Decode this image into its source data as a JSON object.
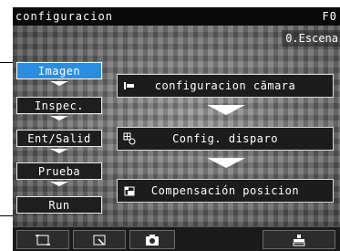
{
  "title": "configuracion",
  "title_right": "F0",
  "scene": "0.Escena",
  "menu": {
    "items": [
      {
        "label": "Imagen",
        "selected": true
      },
      {
        "label": "Inspec.",
        "selected": false
      },
      {
        "label": "Ent/Salid",
        "selected": false
      },
      {
        "label": "Prueba",
        "selected": false
      },
      {
        "label": "Run",
        "selected": false
      }
    ]
  },
  "functions": {
    "camera_label": "configuracion cãmara",
    "trigger_label": "Config. disparo",
    "position_label": "Compensación posicion"
  },
  "icons": {
    "camera_setup": "camera-setup-icon",
    "trigger": "trigger-icon",
    "position": "position-compensation-icon",
    "toolbar": [
      "display-frame-icon",
      "zoom-window-icon",
      "camera-capture-icon",
      "output-icon"
    ]
  },
  "colors": {
    "selected": "#2a8de0",
    "background": "#2a2a2a",
    "text": "#ffffff"
  }
}
